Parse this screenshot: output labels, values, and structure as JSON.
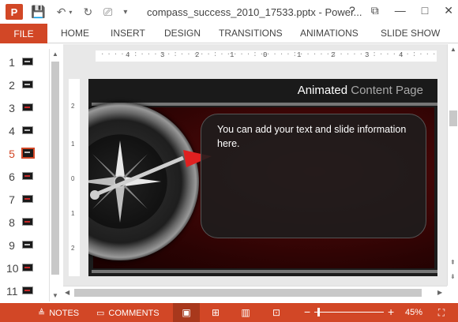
{
  "window": {
    "title": "compass_success_2010_17533.pptx - Power...",
    "help_label": "?",
    "restore_label": "⧉",
    "minimize_label": "—",
    "maximize_label": "□",
    "close_label": "✕"
  },
  "app": {
    "logo_letter": "P",
    "undo_icon": "undo-icon",
    "redo_icon": "redo-icon",
    "save_icon": "save-icon"
  },
  "ribbon": {
    "file_label": "FILE",
    "tabs": [
      "HOME",
      "INSERT",
      "DESIGN",
      "TRANSITIONS",
      "ANIMATIONS",
      "SLIDE SHOW"
    ]
  },
  "thumbnails": {
    "numbers": [
      "1",
      "2",
      "3",
      "4",
      "5",
      "6",
      "7",
      "8",
      "9",
      "10",
      "11"
    ],
    "active_index": 4
  },
  "ruler": {
    "horizontal_labels": [
      "4",
      "3",
      "2",
      "1",
      "0",
      "1",
      "2",
      "3",
      "4"
    ],
    "vertical_labels": [
      "2",
      "1",
      "0",
      "1",
      "2"
    ]
  },
  "slide": {
    "title_bold": "Animated",
    "title_light": "Content Page",
    "body_text": "You can add your text and slide information here."
  },
  "status": {
    "notes_label": "NOTES",
    "comments_label": "COMMENTS",
    "zoom_level": "45%",
    "zoom_minus": "−",
    "zoom_plus": "+"
  },
  "colors": {
    "accent": "#d24726",
    "slide_dark": "#1c1c1c",
    "slide_red": "#5a0b0b"
  }
}
